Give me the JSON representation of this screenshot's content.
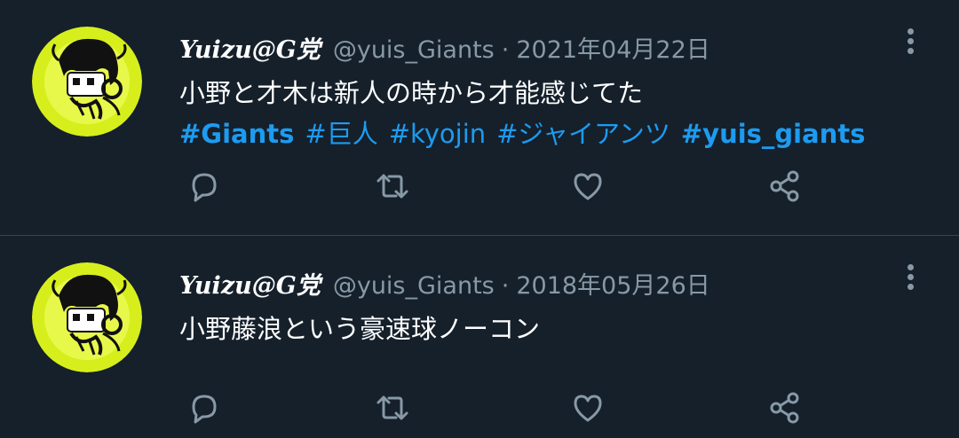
{
  "tweets": [
    {
      "name": "Yuizu@G党",
      "handle": "@yuis_Giants",
      "separator": "·",
      "date": "2021年04月22日",
      "text": "小野と才木は新人の時から才能感じてた",
      "hashtags": [
        {
          "text": "#Giants",
          "bold": true
        },
        {
          "text": "#巨人",
          "bold": false
        },
        {
          "text": "#kyojin",
          "bold": false
        },
        {
          "text": "#ジャイアンツ",
          "bold": false
        },
        {
          "text": "#yuis_giants",
          "bold": true
        }
      ]
    },
    {
      "name": "Yuizu@G党",
      "handle": "@yuis_Giants",
      "separator": "·",
      "date": "2018年05月26日",
      "text": "小野藤浪という豪速球ノーコン",
      "hashtags": []
    }
  ],
  "icons": {
    "reply": "comment-icon",
    "retweet": "retweet-icon",
    "like": "heart-icon",
    "share": "share-icon",
    "more": "more-vertical-icon"
  },
  "colors": {
    "background": "#15202b",
    "hashtag": "#1d9bf0",
    "muted": "#8899a6",
    "avatar_ring": "#d6ef1c"
  }
}
